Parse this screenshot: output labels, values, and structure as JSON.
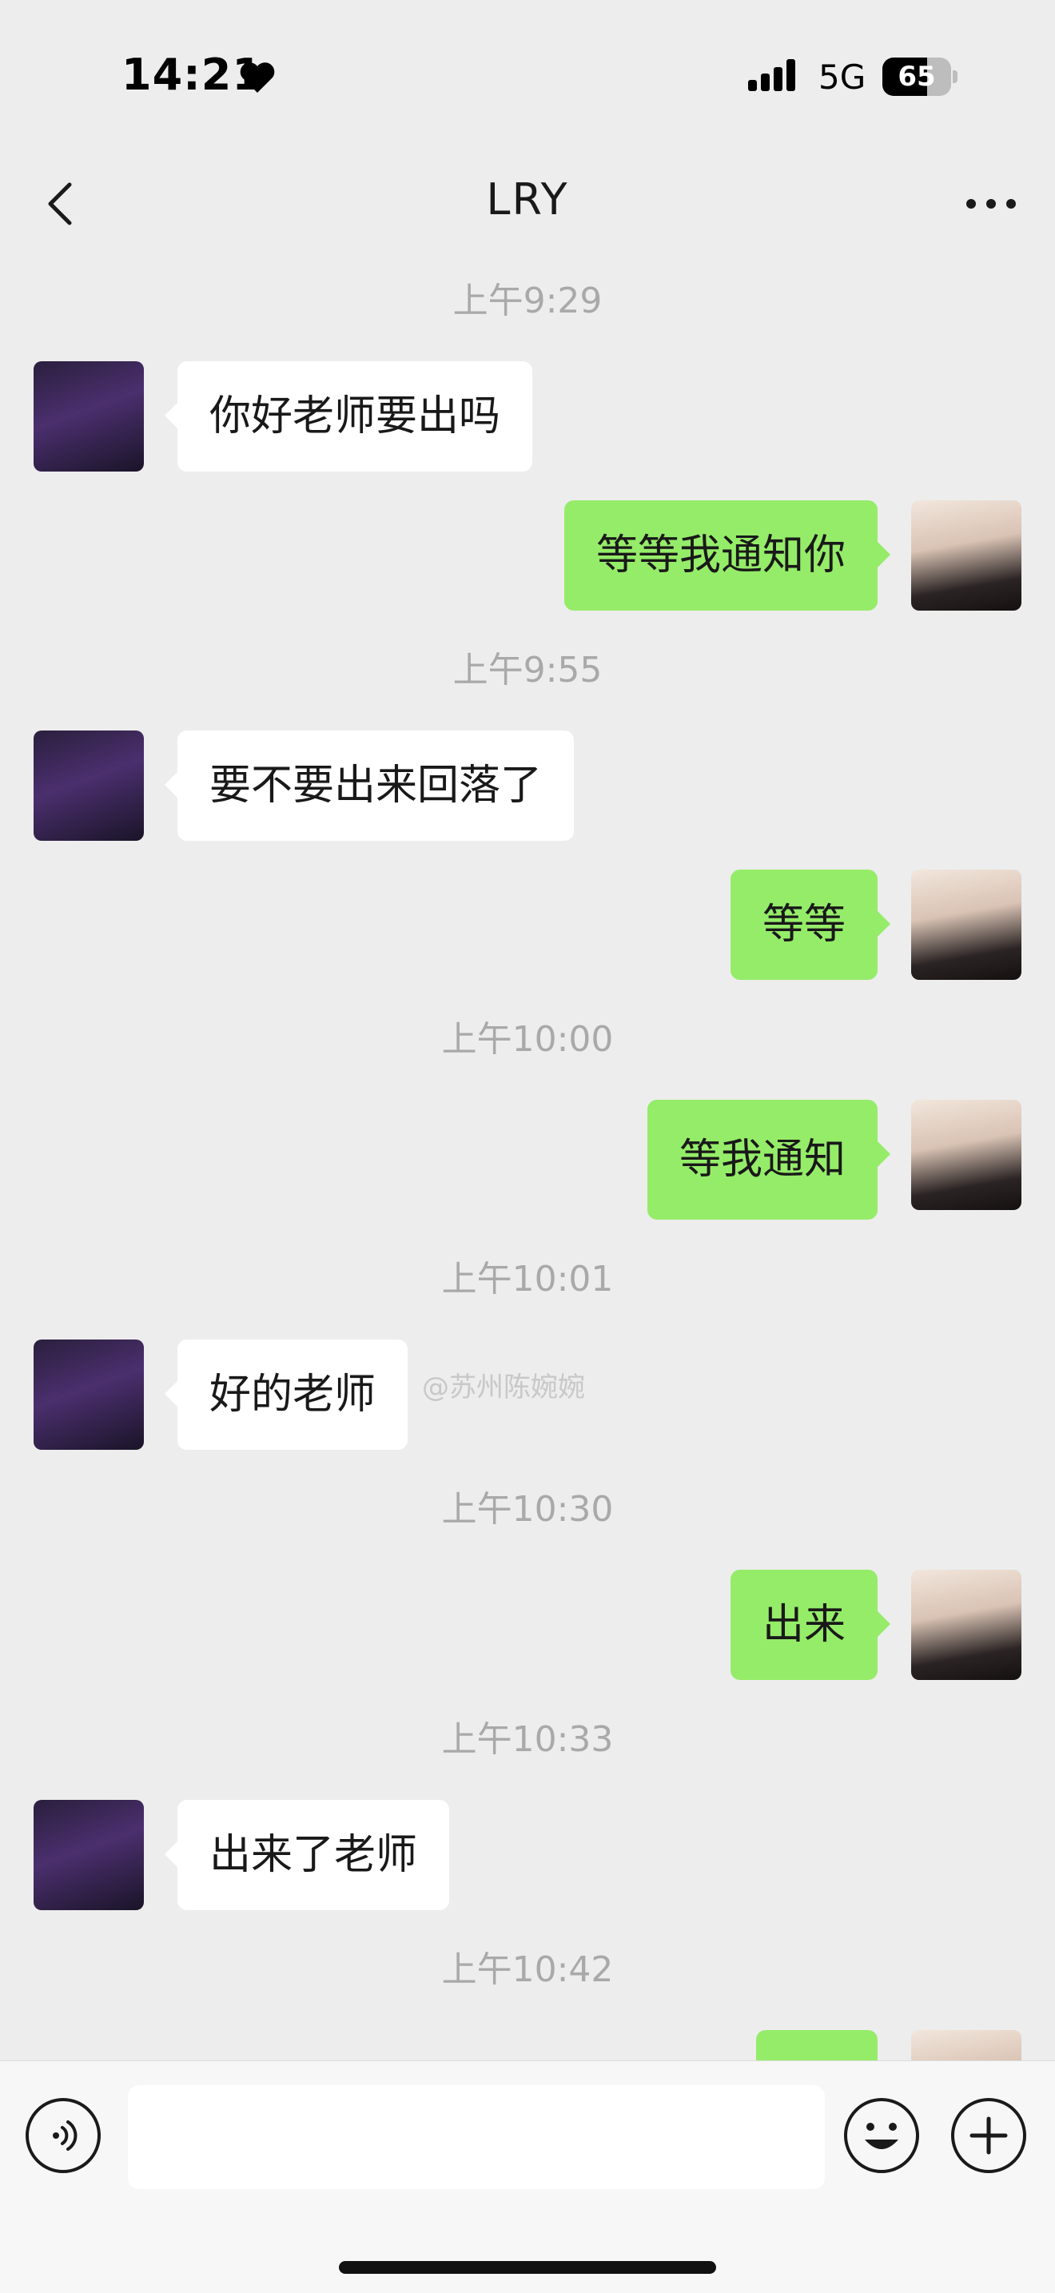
{
  "status_bar": {
    "time": "14:21",
    "heart_icon": "heart-icon",
    "signal_icon": "signal-bars-icon",
    "network": "5G",
    "battery_level": "65",
    "battery_fraction": 0.65
  },
  "nav": {
    "title": "LRY",
    "back_icon": "chevron-left-icon",
    "more_icon": "more-dots-icon"
  },
  "messages": [
    {
      "type": "time",
      "text": "上午9:29"
    },
    {
      "type": "in",
      "text": "你好老师要出吗"
    },
    {
      "type": "out",
      "text": "等等我通知你"
    },
    {
      "type": "time",
      "text": "上午9:55"
    },
    {
      "type": "in",
      "text": "要不要出来回落了"
    },
    {
      "type": "out",
      "text": "等等"
    },
    {
      "type": "time",
      "text": "上午10:00"
    },
    {
      "type": "out",
      "text": "等我通知"
    },
    {
      "type": "time",
      "text": "上午10:01"
    },
    {
      "type": "in",
      "text": "好的老师"
    },
    {
      "type": "time",
      "text": "上午10:30"
    },
    {
      "type": "out",
      "text": "出来"
    },
    {
      "type": "time",
      "text": "上午10:33"
    },
    {
      "type": "in",
      "text": "出来了老师"
    },
    {
      "type": "time",
      "text": "上午10:42"
    },
    {
      "type": "out",
      "text": ""
    }
  ],
  "watermark": "@苏州陈婉婉",
  "input_bar": {
    "placeholder": "",
    "voice_icon": "voice-icon",
    "emoji_icon": "emoji-icon",
    "plus_icon": "plus-icon"
  },
  "colors": {
    "background": "#ededed",
    "outgoing_bubble": "#95ec69",
    "incoming_bubble": "#ffffff",
    "timestamp": "#a9a9a9"
  }
}
